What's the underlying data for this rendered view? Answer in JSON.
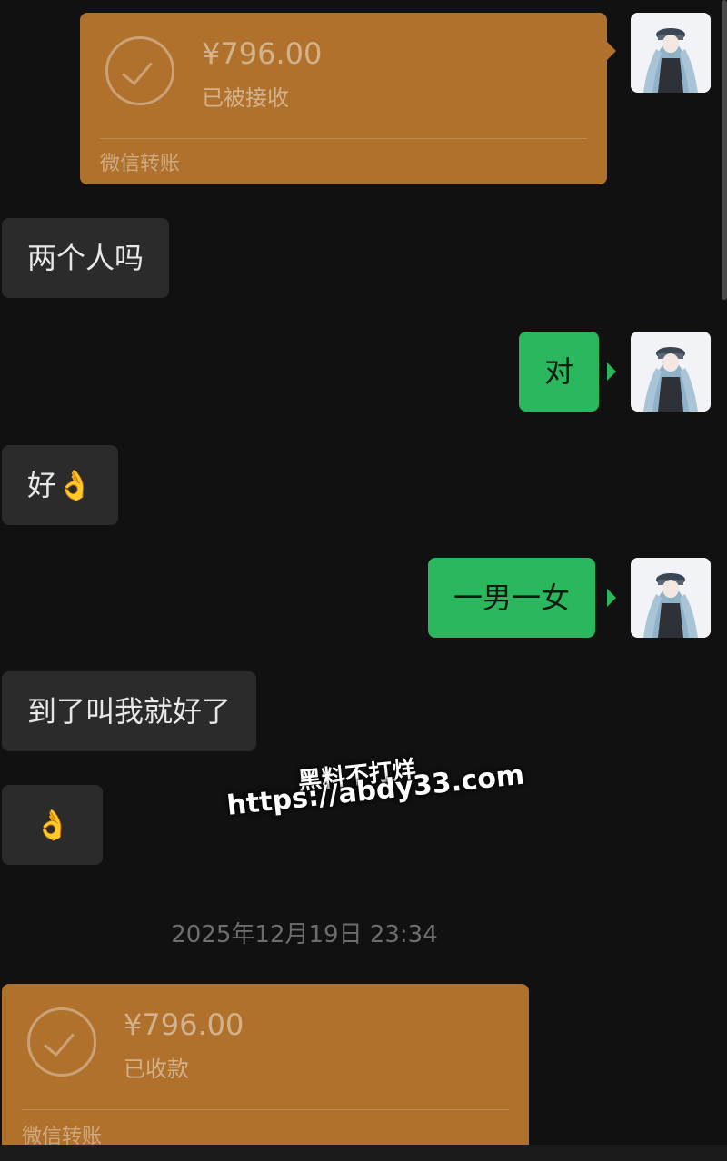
{
  "messages": {
    "transfer_sent": {
      "amount": "¥796.00",
      "status": "已被接收",
      "label": "微信转账"
    },
    "in_1": "两个人吗",
    "out_1": "对",
    "in_2": "好👌",
    "out_2": "一男一女",
    "in_3": "到了叫我就好了",
    "in_4": "👌",
    "timestamp": "2025年12月19日 23:34",
    "transfer_received": {
      "amount": "¥796.00",
      "status": "已收款",
      "label": "微信转账"
    }
  },
  "watermark": {
    "line1": "黑料不打烊",
    "line2": "https://abdy33.com"
  },
  "icons": {
    "avatar": "anime-avatar-icon",
    "transfer": "check-circle-icon"
  },
  "colors": {
    "background": "#111111",
    "transfer_card": "#b0712c",
    "bubble_incoming": "#2b2b2b",
    "bubble_outgoing": "#2ab75d"
  }
}
